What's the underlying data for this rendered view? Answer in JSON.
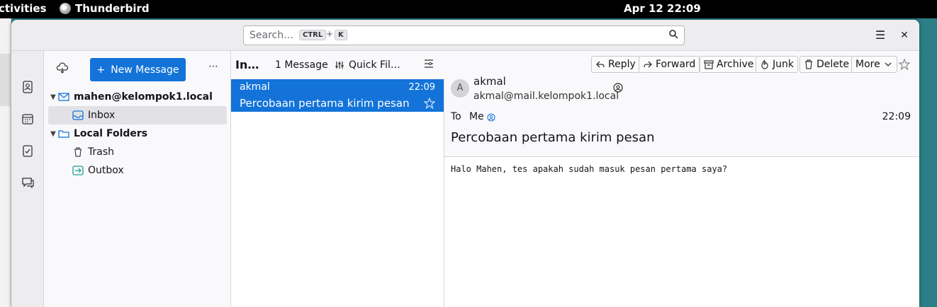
{
  "topbar": {
    "activities": "ctivities",
    "app_name": "Thunderbird",
    "clock": "Apr 12  22:09"
  },
  "search": {
    "placeholder": "Search…",
    "key1": "CTRL",
    "plus": "+",
    "key2": "K"
  },
  "window_controls": {
    "menu": "☰",
    "close": "✕"
  },
  "folder_pane": {
    "new_message": "New Message",
    "new_message_icon": "+",
    "more": "⋯",
    "account": "mahen@kelompok1.local",
    "inbox": "Inbox",
    "local_folders": "Local Folders",
    "trash": "Trash",
    "outbox": "Outbox"
  },
  "message_list": {
    "folder": "In…",
    "count": "1 Message",
    "quick_filter": "Quick Fil…",
    "rows": [
      {
        "from": "akmal",
        "time": "22:09",
        "subject": "Percobaan pertama kirim pesan"
      }
    ]
  },
  "reader": {
    "actions": {
      "reply": "Reply",
      "forward": "Forward",
      "archive": "Archive",
      "junk": "Junk",
      "delete": "Delete",
      "more": "More"
    },
    "avatar": "A",
    "from_name": "akmal",
    "from_email": "akmal@mail.kelompok1.local",
    "to_label": "To",
    "to": "Me",
    "time": "22:09",
    "subject": "Percobaan pertama kirim pesan",
    "body": "Halo Mahen, tes apakah sudah masuk pesan pertama saya?"
  },
  "colors": {
    "accent": "#1373d9",
    "topbar": "#000000",
    "desktop": "#2c7f86"
  }
}
